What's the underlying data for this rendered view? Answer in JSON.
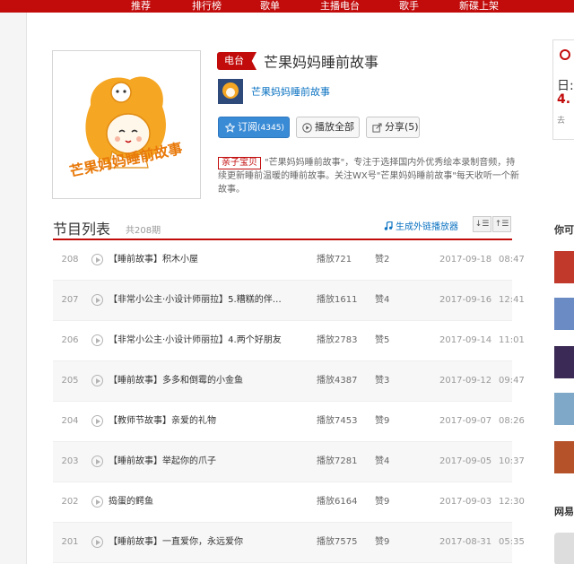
{
  "nav": {
    "items": [
      "推荐",
      "排行榜",
      "歌单",
      "主播电台",
      "歌手",
      "新碟上架"
    ]
  },
  "header": {
    "tag": "电台",
    "title": "芒果妈妈睡前故事",
    "author": "芒果妈妈睡前故事",
    "cover_art_text": "芒果妈妈睡前故事"
  },
  "actions": {
    "subscribe_label": "订阅",
    "subscribe_count": "(4345)",
    "play_all_label": "播放全部",
    "share_label": "分享",
    "share_count": "(5)"
  },
  "description": {
    "category": "亲子宝贝",
    "text": "\"芒果妈妈睡前故事\"，专注于选择国内外优秀绘本录制音频，持续更新睡前温暖的睡前故事。关注WX号\"芒果妈妈睡前故事\"每天收听一个新故事。"
  },
  "program_list": {
    "title": "节目列表",
    "count": "共208期",
    "gen_player_label": "生成外链播放器",
    "sort_asc_icon": "sort-ascending-icon",
    "sort_desc_icon": "sort-descending-icon",
    "rows": [
      {
        "num": "208",
        "name": "【睡前故事】积木小屋",
        "plays": "播放721",
        "likes": "赞2",
        "date": "2017-09-18",
        "duration": "08:47"
      },
      {
        "num": "207",
        "name": "【非常小公主·小设计师丽拉】5.糟糕的伴…",
        "plays": "播放1611",
        "likes": "赞4",
        "date": "2017-09-16",
        "duration": "12:41"
      },
      {
        "num": "206",
        "name": "【非常小公主·小设计师丽拉】4.两个好朋友",
        "plays": "播放2783",
        "likes": "赞5",
        "date": "2017-09-14",
        "duration": "11:01"
      },
      {
        "num": "205",
        "name": "【睡前故事】多多和倒霉的小金鱼",
        "plays": "播放4387",
        "likes": "赞3",
        "date": "2017-09-12",
        "duration": "09:47"
      },
      {
        "num": "204",
        "name": "【教师节故事】亲爱的礼物",
        "plays": "播放7453",
        "likes": "赞9",
        "date": "2017-09-07",
        "duration": "08:26"
      },
      {
        "num": "203",
        "name": "【睡前故事】举起你的爪子",
        "plays": "播放7281",
        "likes": "赞4",
        "date": "2017-09-05",
        "duration": "10:37"
      },
      {
        "num": "202",
        "name": "捣蛋的鳄鱼",
        "plays": "播放6164",
        "likes": "赞9",
        "date": "2017-09-03",
        "duration": "12:30"
      },
      {
        "num": "201",
        "name": "【睡前故事】一直爱你，永远爱你",
        "plays": "播放7575",
        "likes": "赞9",
        "date": "2017-08-31",
        "duration": "05:35"
      }
    ]
  },
  "sidebar": {
    "ad_line1": "日:",
    "ad_line2": "4.",
    "ad_line3": "去",
    "heading1": "你可",
    "heading2": "网易"
  },
  "colors": {
    "brand_red": "#c20c0c",
    "link_blue": "#0c73c2",
    "button_blue": "#3a8bd6"
  }
}
